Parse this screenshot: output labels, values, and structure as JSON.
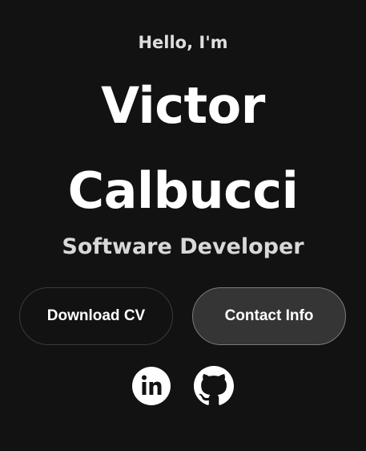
{
  "hero": {
    "greeting": "Hello, I'm",
    "name_first": "Victor",
    "name_last": "Calbucci",
    "role": "Software Developer"
  },
  "buttons": {
    "download_cv": "Download CV",
    "contact_info": "Contact Info"
  },
  "social": [
    {
      "icon": "linkedin-icon"
    },
    {
      "icon": "github-icon"
    }
  ],
  "colors": {
    "background": "#121212",
    "contact_button_bg": "#353535",
    "text": "#ffffff"
  }
}
